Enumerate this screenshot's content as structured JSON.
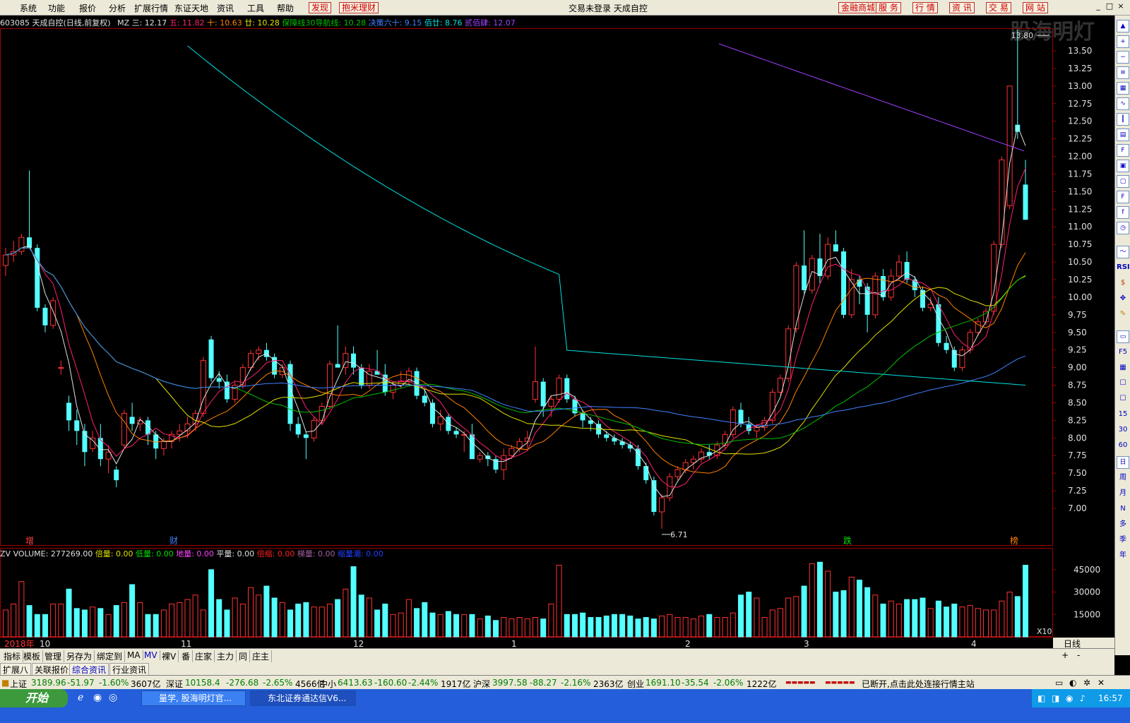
{
  "menu": {
    "items": [
      "系统",
      "功能",
      "报价",
      "分析",
      "扩展行情",
      "东证天地",
      "资讯",
      "工具",
      "帮助"
    ],
    "red_items": [
      "发现",
      "抱米理财"
    ],
    "center_title": "交易未登录  天成自控",
    "right_buttons": [
      "金融商城",
      "服 务",
      "行 情",
      "资 讯",
      "交 易",
      "网 站"
    ],
    "watermark": "股海明灯"
  },
  "legend": {
    "code_name": "603085 天成自控(日线,前复权)",
    "indicator": "MZ",
    "items": [
      {
        "label": "三: 12.17",
        "color": "#e0e0e0"
      },
      {
        "label": "五: 11.82",
        "color": "#ff2070"
      },
      {
        "label": "十: 10.63",
        "color": "#ff8000"
      },
      {
        "label": "廿: 10.28",
        "color": "#e0e000"
      },
      {
        "label": "保障线30导航线: 10.28",
        "color": "#00c000"
      },
      {
        "label": "决策六十: 9.15",
        "color": "#4080ff"
      },
      {
        "label": "佰廿: 8.76",
        "color": "#00e0e0"
      },
      {
        "label": "贰佰肆: 12.07",
        "color": "#a040ff"
      }
    ]
  },
  "price_axis": {
    "ticks": [
      "13.50",
      "13.25",
      "13.00",
      "12.75",
      "12.50",
      "12.25",
      "12.00",
      "11.75",
      "11.50",
      "11.25",
      "11.00",
      "10.75",
      "10.50",
      "10.25",
      "10.00",
      "9.75",
      "9.50",
      "9.25",
      "9.00",
      "8.75",
      "8.50",
      "8.25",
      "8.00",
      "7.75",
      "7.50",
      "7.25",
      "7.00"
    ],
    "high_label": "13.80",
    "low_label": "6.71"
  },
  "event_markers": [
    {
      "text": "增",
      "color": "#ff4040"
    },
    {
      "text": "财",
      "color": "#4080ff"
    },
    {
      "text": "跌",
      "color": "#00e000"
    },
    {
      "text": "榜",
      "color": "#ff8000"
    }
  ],
  "volume": {
    "indicator": "ZV",
    "items": [
      {
        "label": "VOLUME: 277269.00",
        "color": "#e0e0e0"
      },
      {
        "label": "倍量: 0.00",
        "color": "#e0e000"
      },
      {
        "label": "低量: 0.00",
        "color": "#00e000"
      },
      {
        "label": "地量: 0.00",
        "color": "#ff40ff"
      },
      {
        "label": "平量: 0.00",
        "color": "#e0e0e0"
      },
      {
        "label": "倍缩: 0.00",
        "color": "#ff2020"
      },
      {
        "label": "梯量: 0.00",
        "color": "#a060a0"
      },
      {
        "label": "缩量潮: 0.00",
        "color": "#2040ff"
      }
    ],
    "ticks": [
      "45000",
      "30000",
      "15000"
    ],
    "unit": "X10"
  },
  "time_axis": {
    "labels": [
      "2018年",
      "10",
      "11",
      "12",
      "1",
      "2",
      "3",
      "4"
    ],
    "period": "日线"
  },
  "bottom_tabs": [
    "指标",
    "模板",
    "管理",
    "另存为",
    "绑定到",
    "MA",
    "MV",
    "裸V",
    "番",
    "庄家",
    "主力",
    "同",
    "庄主"
  ],
  "info_tabs": [
    "扩展八",
    "关联报价",
    "综合资讯",
    "行业资讯"
  ],
  "right_toolbar": [
    "RSI",
    "F5",
    "15",
    "30",
    "60",
    "日",
    "周",
    "月",
    "N",
    "多",
    "季",
    "年"
  ],
  "status": {
    "sh": {
      "name": "上证",
      "value": "3189.96",
      "chg": "-51.97",
      "pct": "-1.60%",
      "amt": "3607亿"
    },
    "sz": {
      "name": "深证",
      "value": "10158.4",
      "chg": "-276.68",
      "pct": "-2.65%",
      "amt": "4566亿"
    },
    "zx": {
      "name": "中小",
      "value": "6413.63",
      "chg": "-160.60",
      "pct": "-2.44%",
      "amt": "1917亿"
    },
    "hs": {
      "name": "沪深",
      "value": "3997.58",
      "chg": "-88.27",
      "pct": "-2.16%",
      "amt": "2363亿"
    },
    "cy": {
      "name": "创业",
      "value": "1691.10",
      "chg": "-35.54",
      "pct": "-2.06%",
      "amt": "1222亿"
    },
    "message": "已断开,点击此处连接行情主站"
  },
  "taskbar": {
    "start": "开始",
    "tasks": [
      "量学, 股海明灯官...",
      "东北证券通达信V6..."
    ],
    "time": "16:57"
  },
  "chart_data": {
    "type": "candlestick",
    "title": "603085 天成自控(日线,前复权)",
    "ylim": [
      6.6,
      13.9
    ],
    "period": "daily",
    "high": 13.8,
    "low": 6.71,
    "ma_last": {
      "三": 12.17,
      "五": 11.82,
      "十": 10.63,
      "廿": 10.28,
      "保障线30导航线": 10.28,
      "决策六十": 9.15,
      "佰廿": 8.76,
      "贰佰肆": 12.07
    },
    "ohlc": [
      [
        10.45,
        10.7,
        10.3,
        10.6
      ],
      [
        10.6,
        10.8,
        10.5,
        10.65
      ],
      [
        10.65,
        10.9,
        10.6,
        10.85
      ],
      [
        10.85,
        11.8,
        10.8,
        10.7
      ],
      [
        10.7,
        10.75,
        9.8,
        9.85
      ],
      [
        9.85,
        9.9,
        9.5,
        9.6
      ],
      [
        9.6,
        10.0,
        9.55,
        9.95
      ],
      [
        9.0,
        9.1,
        8.9,
        9.0
      ],
      [
        8.5,
        8.6,
        8.1,
        8.25
      ],
      [
        8.25,
        8.4,
        7.9,
        8.1
      ],
      [
        8.1,
        8.2,
        7.6,
        7.8
      ],
      [
        7.85,
        8.1,
        7.8,
        8.0
      ],
      [
        8.0,
        8.2,
        7.6,
        7.7
      ],
      [
        7.7,
        7.9,
        7.5,
        7.8
      ],
      [
        7.55,
        7.6,
        7.3,
        7.4
      ],
      [
        7.9,
        8.4,
        7.85,
        8.35
      ],
      [
        8.3,
        8.5,
        8.1,
        8.2
      ],
      [
        8.2,
        8.3,
        8.1,
        8.25
      ],
      [
        8.25,
        8.3,
        7.9,
        8.05
      ],
      [
        8.05,
        8.1,
        7.7,
        7.85
      ],
      [
        7.85,
        8.0,
        7.75,
        7.95
      ],
      [
        7.95,
        8.1,
        7.85,
        8.05
      ],
      [
        8.05,
        8.2,
        7.95,
        8.1
      ],
      [
        8.1,
        8.3,
        8.0,
        8.2
      ],
      [
        8.2,
        8.4,
        8.1,
        8.35
      ],
      [
        8.35,
        9.15,
        8.3,
        9.1
      ],
      [
        9.4,
        9.45,
        8.8,
        8.85
      ],
      [
        8.85,
        8.95,
        8.7,
        8.8
      ],
      [
        8.8,
        8.9,
        8.5,
        8.55
      ],
      [
        8.55,
        8.8,
        8.5,
        8.75
      ],
      [
        8.75,
        9.05,
        8.7,
        9.0
      ],
      [
        9.0,
        9.25,
        8.95,
        9.2
      ],
      [
        9.2,
        9.3,
        9.1,
        9.25
      ],
      [
        9.25,
        9.35,
        9.1,
        9.15
      ],
      [
        9.15,
        9.2,
        8.85,
        8.9
      ],
      [
        8.9,
        9.05,
        8.85,
        9.0
      ],
      [
        9.05,
        9.1,
        8.1,
        8.2
      ],
      [
        8.2,
        8.3,
        8.0,
        8.05
      ],
      [
        8.05,
        8.1,
        7.7,
        8.0
      ],
      [
        8.0,
        8.3,
        7.95,
        8.25
      ],
      [
        8.25,
        8.5,
        8.2,
        8.45
      ],
      [
        8.45,
        9.1,
        8.4,
        9.05
      ],
      [
        9.05,
        9.6,
        9.0,
        9.0
      ],
      [
        9.0,
        9.3,
        8.9,
        9.2
      ],
      [
        9.2,
        9.3,
        8.9,
        9.0
      ],
      [
        9.0,
        9.05,
        8.7,
        8.75
      ],
      [
        8.75,
        9.05,
        8.7,
        8.95
      ],
      [
        8.95,
        9.25,
        8.9,
        8.9
      ],
      [
        8.9,
        9.05,
        8.6,
        8.65
      ],
      [
        8.65,
        8.8,
        8.55,
        8.75
      ],
      [
        8.75,
        8.95,
        8.7,
        8.8
      ],
      [
        8.8,
        9.0,
        8.75,
        8.95
      ],
      [
        8.95,
        9.0,
        8.55,
        8.6
      ],
      [
        8.6,
        8.7,
        8.45,
        8.5
      ],
      [
        8.5,
        8.55,
        8.15,
        8.2
      ],
      [
        8.2,
        8.4,
        8.1,
        8.3
      ],
      [
        8.3,
        8.35,
        8.05,
        8.1
      ],
      [
        8.1,
        8.15,
        8.0,
        8.05
      ],
      [
        8.05,
        8.1,
        7.8,
        8.05
      ],
      [
        8.05,
        8.2,
        7.95,
        7.7
      ],
      [
        7.7,
        7.8,
        7.65,
        7.75
      ],
      [
        7.75,
        7.8,
        7.6,
        7.7
      ],
      [
        7.7,
        7.75,
        7.5,
        7.55
      ],
      [
        7.55,
        7.85,
        7.4,
        7.75
      ],
      [
        7.75,
        7.9,
        7.7,
        7.85
      ],
      [
        7.85,
        8.0,
        7.8,
        7.95
      ],
      [
        7.95,
        8.1,
        7.85,
        8.0
      ],
      [
        8.55,
        9.3,
        8.5,
        8.8
      ],
      [
        8.8,
        8.85,
        8.3,
        8.45
      ],
      [
        8.45,
        8.6,
        8.3,
        8.55
      ],
      [
        8.55,
        8.9,
        8.5,
        8.85
      ],
      [
        8.85,
        8.9,
        8.5,
        8.55
      ],
      [
        8.55,
        8.6,
        8.3,
        8.35
      ],
      [
        8.35,
        8.4,
        8.15,
        8.25
      ],
      [
        8.25,
        8.3,
        8.1,
        8.2
      ],
      [
        8.2,
        8.25,
        8.0,
        8.05
      ],
      [
        8.05,
        8.1,
        7.95,
        8.0
      ],
      [
        8.0,
        8.05,
        7.9,
        7.95
      ],
      [
        7.95,
        8.0,
        7.85,
        7.9
      ],
      [
        7.9,
        7.95,
        7.8,
        7.85
      ],
      [
        7.85,
        7.9,
        7.55,
        7.6
      ],
      [
        7.6,
        7.65,
        7.35,
        7.4
      ],
      [
        7.4,
        7.45,
        6.9,
        6.95
      ],
      [
        6.95,
        7.2,
        6.71,
        7.15
      ],
      [
        7.15,
        7.5,
        7.1,
        7.45
      ],
      [
        7.45,
        7.6,
        7.4,
        7.55
      ],
      [
        7.55,
        7.7,
        7.5,
        7.65
      ],
      [
        7.65,
        7.75,
        7.55,
        7.7
      ],
      [
        7.7,
        7.85,
        7.65,
        7.8
      ],
      [
        7.8,
        7.9,
        7.7,
        7.75
      ],
      [
        7.75,
        7.95,
        7.7,
        7.9
      ],
      [
        7.9,
        8.1,
        7.85,
        8.05
      ],
      [
        8.05,
        8.45,
        8.0,
        8.4
      ],
      [
        8.4,
        8.5,
        8.15,
        8.2
      ],
      [
        8.2,
        8.3,
        8.05,
        8.1
      ],
      [
        8.1,
        8.2,
        8.0,
        8.15
      ],
      [
        8.15,
        8.3,
        8.1,
        8.25
      ],
      [
        8.25,
        8.7,
        8.2,
        8.65
      ],
      [
        8.65,
        8.9,
        8.6,
        8.85
      ],
      [
        8.85,
        9.6,
        8.8,
        9.55
      ],
      [
        9.55,
        10.5,
        9.5,
        10.45
      ],
      [
        10.45,
        10.95,
        10.05,
        10.1
      ],
      [
        10.1,
        10.6,
        10.05,
        10.55
      ],
      [
        10.55,
        10.9,
        10.2,
        10.3
      ],
      [
        10.3,
        10.85,
        10.25,
        10.75
      ],
      [
        10.75,
        10.95,
        10.7,
        10.65
      ],
      [
        10.65,
        10.7,
        9.7,
        9.75
      ],
      [
        9.75,
        10.4,
        9.7,
        10.25
      ],
      [
        10.25,
        10.3,
        9.9,
        10.15
      ],
      [
        10.15,
        10.2,
        9.5,
        9.75
      ],
      [
        9.75,
        10.35,
        9.7,
        10.3
      ],
      [
        10.3,
        10.4,
        9.95,
        10.0
      ],
      [
        10.0,
        10.4,
        9.95,
        10.3
      ],
      [
        10.3,
        10.6,
        10.25,
        10.5
      ],
      [
        10.5,
        10.65,
        10.2,
        10.25
      ],
      [
        10.25,
        10.3,
        10.0,
        10.1
      ],
      [
        10.1,
        10.15,
        9.8,
        9.85
      ],
      [
        9.85,
        10.0,
        9.8,
        9.9
      ],
      [
        9.9,
        10.0,
        9.3,
        9.35
      ],
      [
        9.35,
        9.45,
        9.2,
        9.25
      ],
      [
        9.25,
        9.3,
        8.95,
        9.0
      ],
      [
        9.0,
        9.3,
        8.95,
        9.25
      ],
      [
        9.25,
        9.55,
        9.2,
        9.5
      ],
      [
        9.5,
        9.7,
        9.45,
        9.65
      ],
      [
        9.65,
        9.85,
        9.6,
        9.8
      ],
      [
        9.8,
        10.8,
        9.75,
        10.75
      ],
      [
        10.75,
        12.0,
        10.7,
        11.95
      ],
      [
        11.3,
        13.0,
        11.25,
        13.0
      ],
      [
        12.45,
        13.8,
        12.25,
        12.35
      ],
      [
        11.6,
        11.95,
        11.1,
        11.1
      ]
    ],
    "volume_x10": [
      1800,
      2200,
      3700,
      2100,
      1500,
      1500,
      2200,
      2200,
      3200,
      1900,
      1800,
      2000,
      1900,
      1500,
      2100,
      2300,
      3500,
      2300,
      1500,
      1500,
      1800,
      2200,
      2300,
      2500,
      2800,
      1800,
      4500,
      2500,
      1800,
      2600,
      2200,
      3300,
      2800,
      3400,
      2600,
      2300,
      1800,
      2200,
      2300,
      2000,
      2000,
      2200,
      2500,
      3200,
      4700,
      2800,
      2600,
      1800,
      2200,
      1500,
      1600,
      2500,
      1900,
      2300,
      1600,
      1500,
      1700,
      1500,
      1500,
      1500,
      1200,
      1400,
      1100,
      1300,
      1200,
      1300,
      1200,
      1300,
      1200,
      2200,
      4800,
      1500,
      1500,
      1600,
      1300,
      1300,
      1400,
      1500,
      1500,
      1400,
      1200,
      1300,
      1200,
      1400,
      1500,
      1300,
      1300,
      1200,
      1400,
      1500,
      1300,
      1300,
      1600,
      2800,
      3000,
      2600,
      1300,
      1800,
      1900,
      2600,
      2700,
      3400,
      4900,
      5000,
      4400,
      3000,
      3100,
      4000,
      3800,
      3300,
      2800,
      2200,
      2400,
      2200,
      2500,
      2500,
      2600,
      1900,
      2400,
      2000,
      2200,
      2000,
      2100,
      1900,
      1800,
      1800,
      2400,
      3000,
      2700,
      4800,
      5800,
      5600,
      5000,
      4300
    ]
  }
}
